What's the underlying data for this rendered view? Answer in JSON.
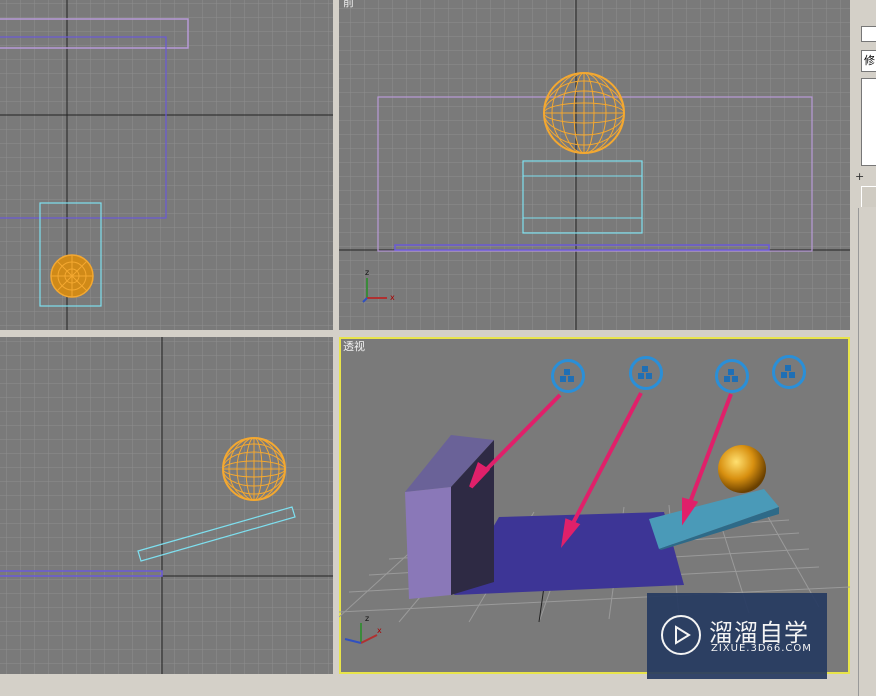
{
  "viewports": {
    "top_left": {
      "label": ""
    },
    "top_right": {
      "label": "前"
    },
    "bottom_left": {
      "label": ""
    },
    "bottom_right": {
      "label": "透视"
    }
  },
  "side_panel": {
    "modify_label": "修"
  },
  "tool_icons": [
    "box-tool-icon",
    "box-tool-icon",
    "box-tool-icon",
    "box-tool-icon"
  ],
  "watermark": {
    "title": "溜溜自学",
    "url": "ZIXUE.3D66.COM"
  },
  "colors": {
    "viewport_bg": "#7a7a7a",
    "active_border": "#e8e44a",
    "sphere": "#f0a020",
    "arrow": "#e0206a",
    "icon_ring": "#2a8fd8"
  }
}
